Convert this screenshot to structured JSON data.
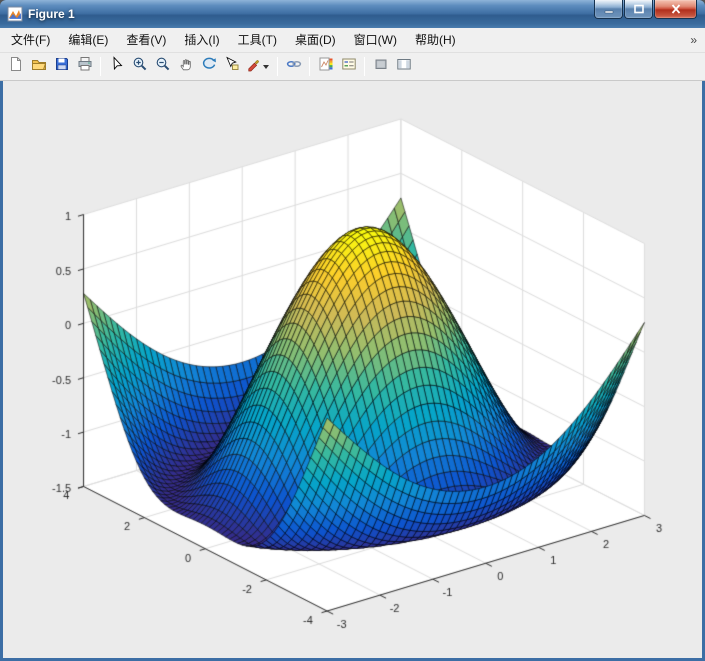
{
  "window": {
    "title": "Figure 1"
  },
  "menu": {
    "items": [
      "文件(F)",
      "编辑(E)",
      "查看(V)",
      "插入(I)",
      "工具(T)",
      "桌面(D)",
      "窗口(W)",
      "帮助(H)"
    ],
    "overflow": "»"
  },
  "toolbar": {
    "buttons": [
      "new-figure",
      "open-file",
      "save-figure",
      "print-figure",
      "edit-plot",
      "zoom-in",
      "zoom-out",
      "pan",
      "rotate-3d",
      "data-cursor",
      "brush",
      "link-plots",
      "insert-colorbar",
      "insert-legend",
      "hide-plot-tools",
      "show-plot-tools"
    ]
  },
  "chart_data": {
    "type": "surface3d",
    "title": "",
    "xlabel": "",
    "ylabel": "",
    "zlabel": "",
    "x_range": [
      -3,
      3
    ],
    "y_range": [
      -4,
      4
    ],
    "z_range": [
      -1.5,
      1
    ],
    "x_ticks": [
      -3,
      -2,
      -1,
      0,
      1,
      2,
      3
    ],
    "y_ticks": [
      -4,
      -2,
      0,
      2,
      4
    ],
    "z_ticks": [
      -1.5,
      -1,
      -0.5,
      0,
      0.5,
      1
    ],
    "grid": true,
    "view": {
      "azimuth": -37.5,
      "elevation": 30
    },
    "mesh": {
      "nx": 49,
      "ny": 61
    },
    "z_formula": "Math.cos(R) - 0.3*Math.exp(-((R - Math.PI)*(R - Math.PI)))",
    "colormap": "parula",
    "colormap_stops": [
      [
        0,
        "#352a87"
      ],
      [
        0.125,
        "#0d53ce"
      ],
      [
        0.25,
        "#1286d6"
      ],
      [
        0.375,
        "#06a5c8"
      ],
      [
        0.5,
        "#33b8a1"
      ],
      [
        0.625,
        "#8fbe70"
      ],
      [
        0.75,
        "#d0ba56"
      ],
      [
        0.875,
        "#fbcd2b"
      ],
      [
        1,
        "#f8fa0d"
      ]
    ],
    "edge_color": "#000000",
    "wall_color": "#ffffff",
    "grid_color": "#dcdcdc",
    "axis_color": "#2b2b2b",
    "figure_bg": "#ebebeb"
  }
}
